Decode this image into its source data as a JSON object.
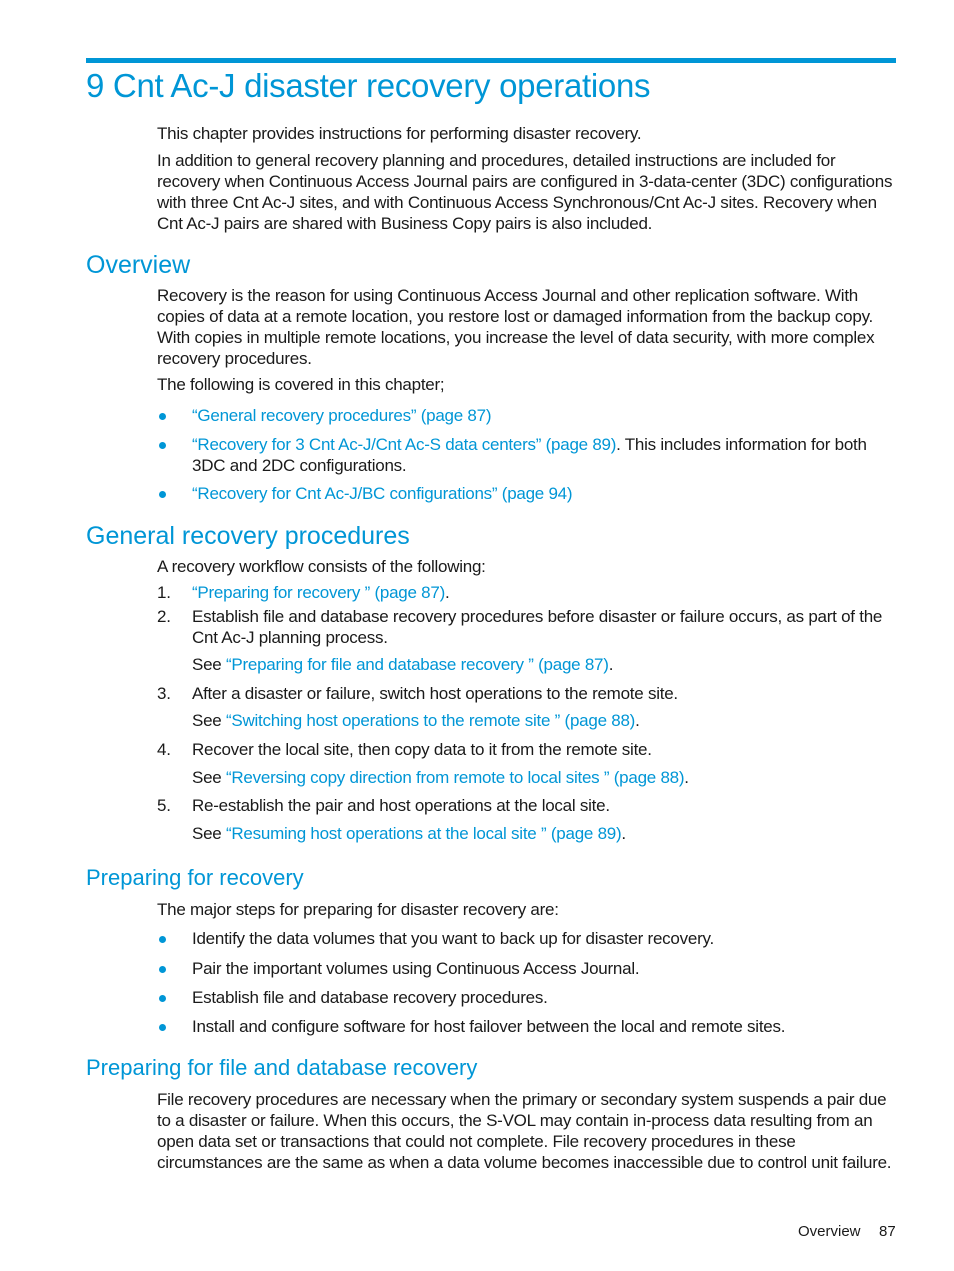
{
  "chapter": {
    "title": "9 Cnt Ac-J disaster recovery operations",
    "intro": [
      "This chapter provides instructions for performing disaster recovery.",
      "In addition to general recovery planning and procedures, detailed instructions are included for recovery when Continuous Access Journal pairs are configured in 3-data-center (3DC) configurations with three Cnt Ac-J sites, and with Continuous Access Synchronous/Cnt Ac-J sites. Recovery when Cnt Ac-J pairs are shared with Business Copy pairs is also included."
    ]
  },
  "overview": {
    "heading": "Overview",
    "paragraph": "Recovery is the reason for using Continuous Access Journal and other replication software. With copies of data at a remote location, you restore lost or damaged information from the backup copy. With copies in multiple remote locations, you increase the level of data security, with more complex recovery procedures.",
    "covered_intro": "The following is covered in this chapter;",
    "items": [
      {
        "link": "“General recovery procedures” (page 87)",
        "suffix": ""
      },
      {
        "link": "“Recovery for 3 Cnt Ac-J/Cnt Ac-S data centers” (page 89)",
        "suffix": ". This includes information for both 3DC and 2DC configurations."
      },
      {
        "link": "“Recovery for Cnt Ac-J/BC configurations” (page 94)",
        "suffix": ""
      }
    ]
  },
  "general": {
    "heading": "General recovery procedures",
    "intro": "A recovery workflow consists of the following:",
    "steps": [
      {
        "num": "1.",
        "text": "",
        "link": "“Preparing for recovery ” (page 87)",
        "link_suffix": "."
      },
      {
        "num": "2.",
        "text": "Establish file and database recovery procedures before disaster or failure occurs, as part of the Cnt Ac-J planning process.",
        "see": "See ",
        "see_link": "“Preparing for file and database recovery ” (page 87)",
        "see_suffix": "."
      },
      {
        "num": "3.",
        "text": "After a disaster or failure, switch host operations to the remote site.",
        "see": "See ",
        "see_link": "“Switching host operations to the remote site ” (page 88)",
        "see_suffix": "."
      },
      {
        "num": "4.",
        "text": "Recover the local site, then copy data to it from the remote site.",
        "see": "See ",
        "see_link": "“Reversing copy direction from remote to local sites ” (page 88)",
        "see_suffix": "."
      },
      {
        "num": "5.",
        "text": "Re-establish the pair and host operations at the local site.",
        "see": "See ",
        "see_link": "“Resuming host operations at the local site ” (page 89)",
        "see_suffix": "."
      }
    ]
  },
  "preparing": {
    "heading": "Preparing for recovery",
    "intro": "The major steps for preparing for disaster recovery are:",
    "items": [
      "Identify the data volumes that you want to back up for disaster recovery.",
      "Pair the important volumes using Continuous Access Journal.",
      "Establish file and database recovery procedures.",
      "Install and configure software for host failover between the local and remote sites."
    ]
  },
  "file_db": {
    "heading": "Preparing for file and database recovery",
    "paragraph": "File recovery procedures are necessary when the primary or secondary system suspends a pair due to a disaster or failure. When this occurs, the S-VOL may contain in-process data resulting from an open data set or transactions that could not complete. File recovery procedures in these circumstances are the same as when a data volume becomes inaccessible due to control unit failure."
  },
  "footer": {
    "section": "Overview",
    "page": "87"
  },
  "colors": {
    "accent": "#0096d6",
    "text": "#1a1a1a"
  }
}
